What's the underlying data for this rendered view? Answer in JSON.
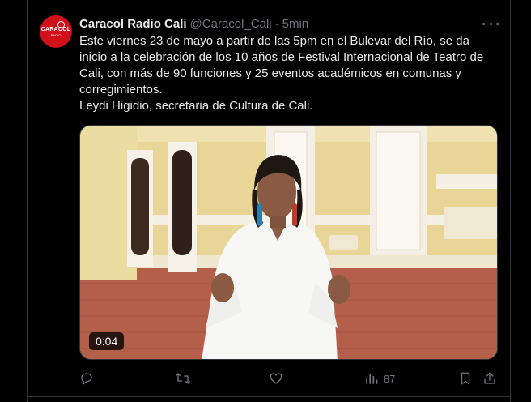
{
  "tweet": {
    "display_name": "Caracol Radio Cali",
    "handle": "@Caracol_Cali",
    "separator": "·",
    "time": "5min",
    "avatar": {
      "text": "CARACOL",
      "subtext": "RADIO",
      "color": "#d0101a"
    },
    "text_lines": [
      "Este viernes 23 de mayo a partir de las 5pm en el Bulevar del Río, se da",
      "inicio a la celebración de los 10 años de Festival Internacional de Teatro de",
      "Cali, con más de 90 funciones y 25 eventos académicos en comunas y",
      "corregimientos.",
      "Leydi Higidio, secretaria de Cultura de Cali."
    ],
    "media": {
      "type": "video",
      "duration": "0:04"
    },
    "actions": {
      "reply_icon": "reply-icon",
      "retweet_icon": "retweet-icon",
      "like_icon": "heart-icon",
      "views_icon": "views-icon",
      "views_count": "87",
      "bookmark_icon": "bookmark-icon",
      "share_icon": "share-icon"
    }
  },
  "colors": {
    "background": "#000000",
    "text": "#e7e9ea",
    "muted": "#71767b",
    "border": "#2f3336"
  }
}
